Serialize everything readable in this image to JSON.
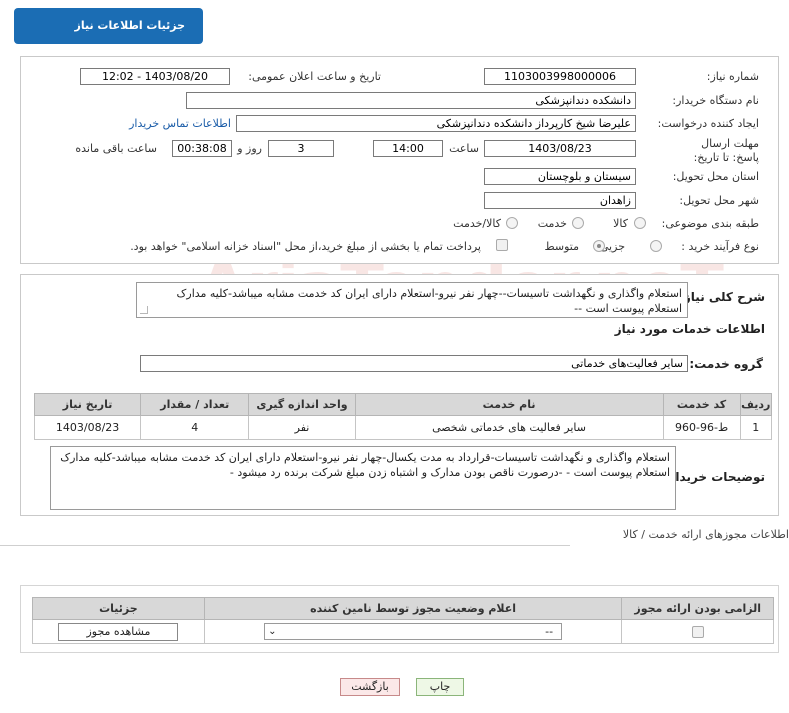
{
  "header": {
    "title": "جزئیات اطلاعات نیاز"
  },
  "fields": {
    "need_number_label": "شماره نیاز:",
    "need_number": "1103003998000006",
    "announce_label": "تاریخ و ساعت اعلان عمومی:",
    "announce_value": "1403/08/20 - 12:02",
    "buyer_org_label": "نام دستگاه خریدار:",
    "buyer_org": "دانشکده دندانپزشکی",
    "creator_label": "ایجاد کننده درخواست:",
    "creator": "علیرضا شیخ کارپرداز دانشکده دندانپزشکی",
    "buyer_contact_link": "اطلاعات تماس خریدار",
    "deadline_label": "مهلت ارسال پاسخ: تا تاریخ:",
    "deadline_date": "1403/08/23",
    "time_label": "ساعت",
    "deadline_time": "14:00",
    "days_value": "3",
    "days_label": "روز و",
    "remaining_time": "00:38:08",
    "remaining_label": "ساعت باقی مانده",
    "province_label": "استان محل تحویل:",
    "province": "سیستان و بلوچستان",
    "city_label": "شهر محل تحویل:",
    "city": "زاهدان",
    "category_label": "طبقه بندی موضوعی:",
    "category_options": [
      "کالا",
      "خدمت",
      "کالا/خدمت"
    ],
    "purchase_type_label": "نوع فرآیند خرید :",
    "purchase_options": [
      "جزیی",
      "متوسط"
    ],
    "payment_note": "پرداخت تمام یا بخشی از مبلغ خرید،از محل \"اسناد خزانه اسلامی\" خواهد بود."
  },
  "summary": {
    "label": "شرح کلی نیاز:",
    "text": "استعلام واگذاری و نگهداشت تاسیسات--چهار نفر نیرو-استعلام دارای ایران کد خدمت مشابه میباشد-کلیه مدارک استعلام پیوست است --"
  },
  "services": {
    "section_title": "اطلاعات خدمات مورد نیاز",
    "group_label": "گروه خدمت:",
    "group_value": "سایر فعالیت‌های خدماتی",
    "columns": [
      "ردیف",
      "کد خدمت",
      "نام خدمت",
      "واحد اندازه گیری",
      "تعداد / مقدار",
      "تاریخ نیاز"
    ],
    "rows": [
      [
        "1",
        "ط-96-960",
        "سایر فعالیت های خدماتی شخصی",
        "نفر",
        "4",
        "1403/08/23"
      ]
    ]
  },
  "buyer_notes": {
    "label": "توضیحات خریدار:",
    "text": "استعلام واگذاری و نگهداشت تاسیسات-قرارداد به مدت یکسال-چهار نفر نیرو-استعلام دارای ایران کد خدمت مشابه میباشد-کلیه مدارک استعلام پیوست است - -درصورت ناقص بودن مدارک و اشتباه زدن مبلغ شرکت برنده رد میشود -"
  },
  "permits": {
    "section_title": "اطلاعات مجوزهای ارائه خدمت / کالا",
    "columns": [
      "الزامی بودن ارائه مجوز",
      "اعلام وضعیت مجوز توسط نامین کننده",
      "جزئیات"
    ],
    "select_value": "--",
    "view_button": "مشاهده مجوز"
  },
  "actions": {
    "print": "چاپ",
    "back": "بازگشت"
  },
  "watermark": "AriaTender.neT"
}
